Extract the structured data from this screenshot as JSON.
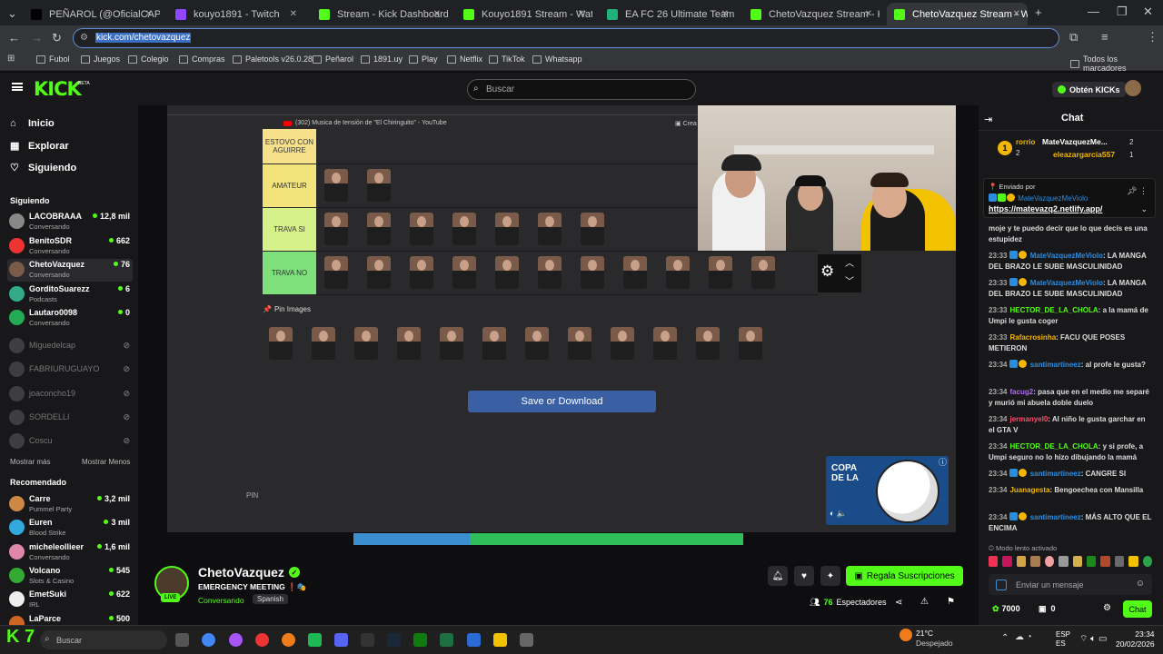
{
  "browser": {
    "tabs": [
      {
        "label": "PEÑAROL (@OficialCAP) / X",
        "color": "#000000"
      },
      {
        "label": "kouyo1891 - Twitch",
        "color": "#9146ff"
      },
      {
        "label": "Stream - Kick Dashboard",
        "color": "#53fc18"
      },
      {
        "label": "Kouyo1891 Stream - Watch",
        "color": "#53fc18"
      },
      {
        "label": "EA FC 26 Ultimate Team Prices,",
        "color": "#1fb37a"
      },
      {
        "label": "ChetoVazquez Stream - Kick Da",
        "color": "#53fc18"
      },
      {
        "label": "ChetoVazquez Stream - Watch",
        "color": "#53fc18"
      }
    ],
    "url": "kick.com/chetovazquez",
    "bookmarks": [
      "Fubol",
      "Juegos",
      "Colegio",
      "Compras",
      "Paletools v26.0.28",
      "Peñarol",
      "1891.uy",
      "Play",
      "Netflix",
      "TikTok",
      "Whatsapp"
    ],
    "all_bookmarks": "Todos los marcadores"
  },
  "header": {
    "logo": "KICK",
    "logo_beta": "BETA",
    "search_placeholder": "Buscar",
    "get_kicks": "Obtén KICKs"
  },
  "sidebar": {
    "nav": [
      {
        "label": "Inicio",
        "icon": "home-icon"
      },
      {
        "label": "Explorar",
        "icon": "compass-icon"
      },
      {
        "label": "Siguiendo",
        "icon": "heart-icon"
      }
    ],
    "following_title": "Siguiendo",
    "following": [
      {
        "name": "LACOBRAAA",
        "category": "Conversando",
        "viewers": "12,8 mil",
        "live": true
      },
      {
        "name": "BenitoSDR",
        "category": "Conversando",
        "viewers": "662",
        "live": true
      },
      {
        "name": "ChetoVazquez",
        "category": "Conversando",
        "viewers": "76",
        "live": true
      },
      {
        "name": "GorditoSuarezz",
        "category": "Podcasts",
        "viewers": "6",
        "live": true
      },
      {
        "name": "Lautaro0098",
        "category": "Conversando",
        "viewers": "0",
        "live": true
      },
      {
        "name": "Miguedelcap",
        "live": false
      },
      {
        "name": "FABRIURUGUAYO",
        "live": false
      },
      {
        "name": "joaconcho19",
        "live": false
      },
      {
        "name": "SORDELLI",
        "live": false
      },
      {
        "name": "Coscu",
        "live": false
      }
    ],
    "show_more": "Mostrar más",
    "show_less": "Mostrar Menos",
    "recommended_title": "Recomendado",
    "recommended": [
      {
        "name": "Carre",
        "category": "Pummel Party",
        "viewers": "3,2 mil"
      },
      {
        "name": "Euren",
        "category": "Blood Strike",
        "viewers": "3 mil"
      },
      {
        "name": "micheleollieer",
        "category": "Conversando",
        "viewers": "1,6 mil"
      },
      {
        "name": "Volcano",
        "category": "Slots & Casino",
        "viewers": "545"
      },
      {
        "name": "EmetSuki",
        "category": "IRL",
        "viewers": "622"
      },
      {
        "name": "LaParce",
        "category": "",
        "viewers": "500"
      }
    ]
  },
  "stream": {
    "youtube_tab": "(302) Musica de tensión de \"El Chiringuito\" - YouTube",
    "tiers": [
      {
        "label": "ESTOVO CON AGUIRRE",
        "color": "#f7e08a"
      },
      {
        "label": "AMATEUR",
        "color": "#f2e47b"
      },
      {
        "label": "TRAVA SI",
        "color": "#d7f18a"
      },
      {
        "label": "TRAVA NO",
        "color": "#7ee07a"
      }
    ],
    "pin_images": "Pin Images",
    "save_button": "Save or Download",
    "pin_text": "PIN"
  },
  "channel": {
    "name": "ChetoVazquez",
    "title": "EMERGENCY MEETING",
    "category": "Conversando",
    "language": "Spanish",
    "live_badge": "LIVE",
    "subscribe_gift": "Regala Suscripciones",
    "viewers": "76",
    "viewers_label": "Espectadores"
  },
  "chat": {
    "title": "Chat",
    "top_gifters": [
      {
        "name": "rorrio",
        "count": "2"
      },
      {
        "name": "MateVazquezMe...",
        "count": "2"
      },
      {
        "name": "eleazargarcia557",
        "count": "1"
      }
    ],
    "pinned_label": "Enviado por",
    "pinned_user": "MateVazquezMeViolo",
    "pinned_link": "https://matevazq2.netlify.app/",
    "messages": [
      {
        "time": "",
        "user": "",
        "text": "moje y te puedo decir que lo que decís es una estupidez"
      },
      {
        "time": "23:33",
        "user": "MateVazquezMeViolo",
        "color": "#2b8de0",
        "text": "LA MANGA DEL BRAZO LE SUBE MASCULINIDAD"
      },
      {
        "time": "23:33",
        "user": "MateVazquezMeViolo",
        "color": "#2b8de0",
        "text": "LA MANGA DEL BRAZO LE SUBE MASCULINIDAD"
      },
      {
        "time": "23:33",
        "user": "HECTOR_DE_LA_CHOLA",
        "color": "#53fc18",
        "text": "a la mamá de Umpi le gusta coger"
      },
      {
        "time": "23:33",
        "user": "Rafacrosinha",
        "color": "#f2b705",
        "text": "FACU QUE POSES METIERON"
      },
      {
        "time": "23:34",
        "user": "santimartineez",
        "color": "#2b8de0",
        "text": "al profe le gusta?"
      },
      {
        "time": "23:34",
        "user": "facug2",
        "color": "#b468ff",
        "text": "pasa que en el medio me separé y murió mi abuela doble duelo"
      },
      {
        "time": "23:34",
        "user": "jermanyel0",
        "color": "#ff4d6d",
        "text": "Al niño le gusta garchar en el GTA V"
      },
      {
        "time": "23:34",
        "user": "HECTOR_DE_LA_CHOLA",
        "color": "#53fc18",
        "text": "y si profe, a Umpi seguro no lo hizo dibujando la mamá"
      },
      {
        "time": "23:34",
        "user": "santimartineez",
        "color": "#2b8de0",
        "text": "CANGRE SI"
      },
      {
        "time": "23:34",
        "user": "Juanagesta",
        "color": "#f2b705",
        "text": "Bengoechea con Mansilla"
      },
      {
        "time": "23:34",
        "user": "santimartineez",
        "color": "#2b8de0",
        "text": "MÁS ALTO QUE EL ENCIMA"
      }
    ],
    "slow_mode": "Modo lento activado",
    "input_placeholder": "Enviar un mensaje",
    "kicks": "7000",
    "points": "0",
    "send": "Chat"
  },
  "taskbar": {
    "search": "Buscar",
    "weather_temp": "21°C",
    "weather_desc": "Despejado",
    "lang": "ESP",
    "lang2": "ES",
    "time": "23:34",
    "date": "20/02/2026"
  }
}
